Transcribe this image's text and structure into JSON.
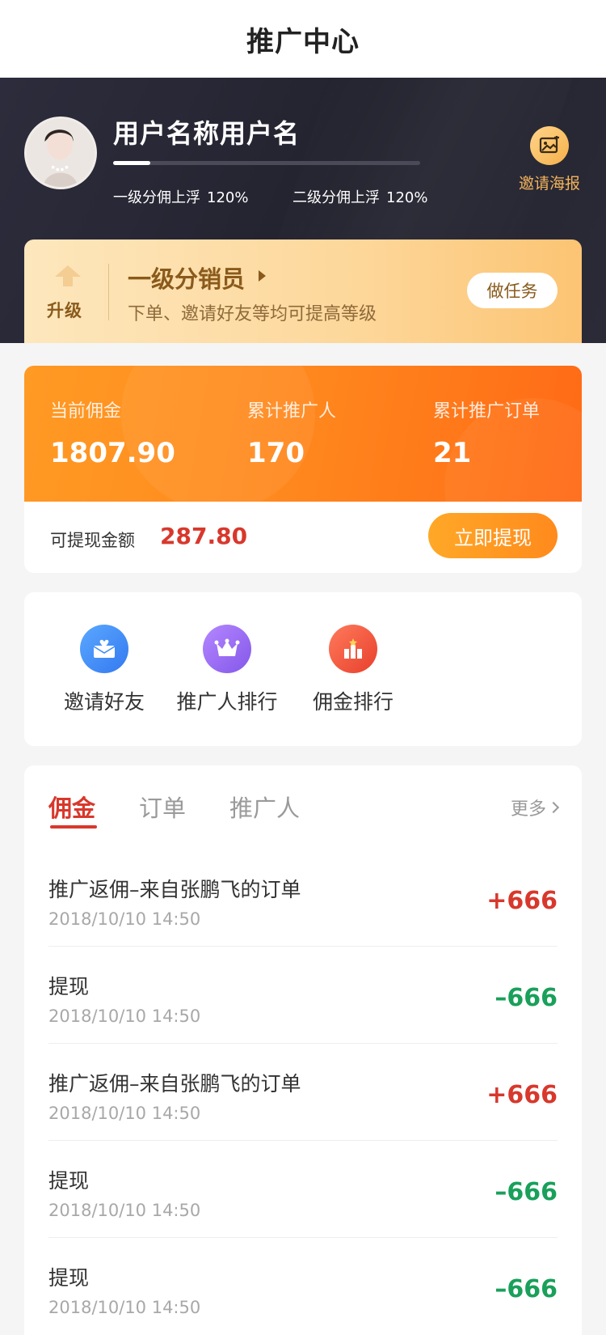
{
  "header": {
    "title": "推广中心"
  },
  "profile": {
    "username": "用户名称用户名",
    "level_progress_percent": 12,
    "rates": [
      {
        "label": "一级分佣上浮",
        "value": "120%"
      },
      {
        "label": "二级分佣上浮",
        "value": "120%"
      }
    ],
    "poster": {
      "label": "邀请海报",
      "icon": "image-icon"
    }
  },
  "level": {
    "upgrade_label": "升级",
    "title": "一级分销员",
    "subtitle": "下单、邀请好友等均可提高等级",
    "task_button": "做任务"
  },
  "stats": {
    "items": [
      {
        "label": "当前佣金",
        "value": "1807.90"
      },
      {
        "label": "累计推广人",
        "value": "170"
      },
      {
        "label": "累计推广订单",
        "value": "21"
      }
    ],
    "withdrawable_label": "可提现金额",
    "withdrawable_amount": "287.80",
    "withdraw_button": "立即提现"
  },
  "actions": [
    {
      "label": "邀请好友",
      "icon": "envelope-heart-icon",
      "color": "#3e8ef7"
    },
    {
      "label": "推广人排行",
      "icon": "crown-icon",
      "color": "#9b6cf2"
    },
    {
      "label": "佣金排行",
      "icon": "bar-chart-icon",
      "color": "#f0503a"
    }
  ],
  "records": {
    "tabs": [
      "佣金",
      "订单",
      "推广人"
    ],
    "active_tab": 0,
    "more_label": "更多",
    "items": [
      {
        "title": "推广返佣–来自张鹏飞的订单",
        "time": "2018/10/10 14:50",
        "amount": "+666",
        "type": "plus"
      },
      {
        "title": "提现",
        "time": "2018/10/10 14:50",
        "amount": "–666",
        "type": "minus"
      },
      {
        "title": "推广返佣–来自张鹏飞的订单",
        "time": "2018/10/10 14:50",
        "amount": "+666",
        "type": "plus"
      },
      {
        "title": "提现",
        "time": "2018/10/10 14:50",
        "amount": "–666",
        "type": "minus"
      },
      {
        "title": "提现",
        "time": "2018/10/10 14:50",
        "amount": "–666",
        "type": "minus"
      }
    ]
  },
  "colors": {
    "accent_red": "#d8382c",
    "accent_green": "#19a05a",
    "accent_orange": "#ff8a1e",
    "gold": "#8a5a1c"
  }
}
